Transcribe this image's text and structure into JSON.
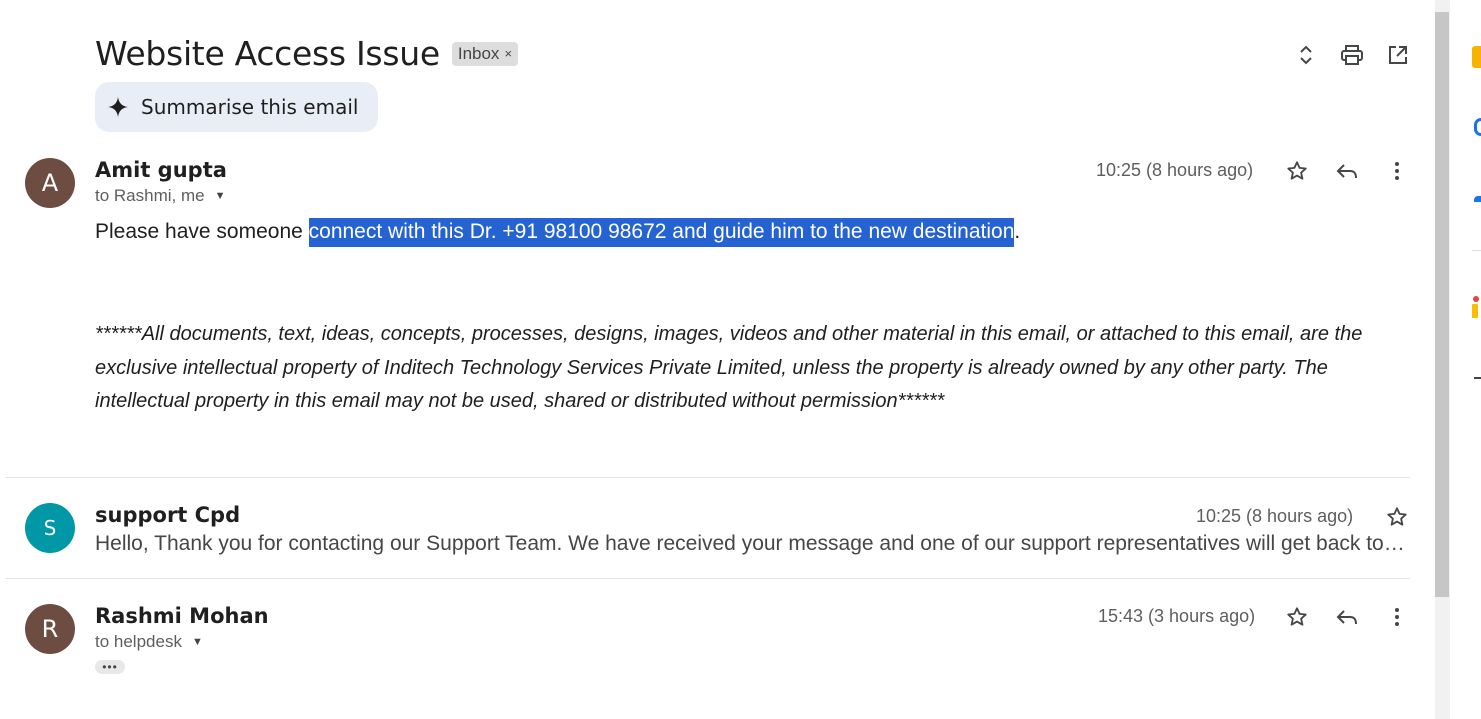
{
  "thread": {
    "subject": "Website Access Issue",
    "label": "Inbox",
    "label_remove_glyph": "×",
    "summarise_label": "Summarise this email",
    "toolbar_icons": [
      "expand-collapse-icon",
      "print-icon",
      "open-in-new-window-icon"
    ]
  },
  "messages": [
    {
      "avatar_letter": "A",
      "avatar_color": "#6d4c41",
      "sender": "Amit gupta",
      "to": "to Rashmi, me",
      "time": "10:25 (8 hours ago)",
      "body_prefix": "Please have someone ",
      "body_highlight": "connect with this Dr. +91 98100 98672 and guide him to the new destination",
      "body_suffix": ".",
      "disclaimer": "******All documents, text, ideas, concepts, processes, designs, images, videos and other material in this email, or attached to this email, are the exclusive intellectual property of Inditech Technology Services Private Limited, unless the property is already owned by any other party. The intellectual property in this email may not be used, shared or distributed without permission******"
    },
    {
      "avatar_letter": "S",
      "avatar_color": "#0097a7",
      "sender": "support Cpd",
      "time": "10:25 (8 hours ago)",
      "snippet": "Hello, Thank you for contacting our Support Team. We have received your message and one of our support representatives will get back to you shortly."
    },
    {
      "avatar_letter": "R",
      "avatar_color": "#6d4c41",
      "sender": "Rashmi Mohan",
      "to": "to helpdesk",
      "time": "15:43 (3 hours ago)",
      "trimmed_content_glyph": "•••"
    }
  ],
  "colors": {
    "selection_highlight": "#2563d2",
    "summarise_bg": "#e9eef6",
    "label_chip_bg": "#dddddd"
  }
}
